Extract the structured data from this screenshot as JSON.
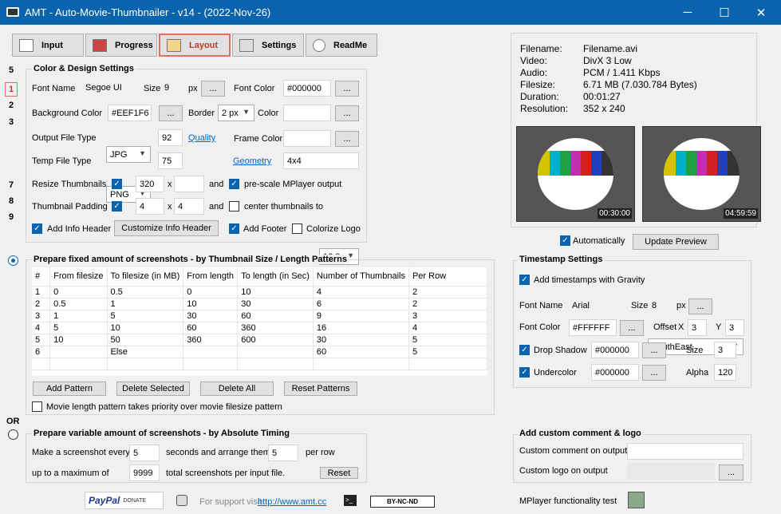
{
  "window": {
    "title": "AMT - Auto-Movie-Thumbnailer - v14 - (2022-Nov-26)",
    "minimize": "─",
    "maximize": "☐",
    "close": "✕"
  },
  "tabs": [
    {
      "label": "Input"
    },
    {
      "label": "Progress"
    },
    {
      "label": "Layout"
    },
    {
      "label": "Settings"
    },
    {
      "label": "ReadMe"
    }
  ],
  "side_nums": [
    "5",
    "1",
    "2",
    "3",
    "7",
    "8",
    "9"
  ],
  "color_design": {
    "title": "Color & Design Settings",
    "font_name_label": "Font Name",
    "font_name": "Segoe UI",
    "size_label": "Size",
    "size": "9",
    "px": "px",
    "dots": "...",
    "font_color_label": "Font Color",
    "font_color": "#000000",
    "bg_color_label": "Background Color",
    "bg_color": "#EEF1F6",
    "border_label": "Border",
    "border": "2 px",
    "color_label": "Color",
    "color": "",
    "output_type_label": "Output File Type",
    "output_type": "JPG",
    "quality_value": "92",
    "quality_link": "Quality",
    "frame_color_label": "Frame Color",
    "frame_color": "",
    "temp_type_label": "Temp File Type",
    "temp_type": "PNG",
    "temp_value": "75",
    "geometry_link": "Geometry",
    "geometry": "4x4",
    "resize_label": "Resize Thumbnails",
    "resize_w": "320",
    "x": "x",
    "resize_h": "",
    "and": "and",
    "prescale_label": "pre-scale MPlayer output",
    "padding_label": "Thumbnail Padding",
    "pad_x": "4",
    "pad_y": "4",
    "center_label": "center thumbnails to",
    "ratio": "16:9",
    "add_info_label": "Add Info Header",
    "customize_btn": "Customize Info Header",
    "add_footer_label": "Add Footer",
    "colorize_label": "Colorize Logo"
  },
  "info": {
    "rows": [
      {
        "k": "Filename:",
        "v": "Filename.avi"
      },
      {
        "k": "Video:",
        "v": "DivX 3 Low"
      },
      {
        "k": "Audio:",
        "v": "PCM / 1.411 Kbps"
      },
      {
        "k": "Filesize:",
        "v": "6.71 MB (7.030.784 Bytes)"
      },
      {
        "k": "Duration:",
        "v": "00:01:27"
      },
      {
        "k": "Resolution:",
        "v": "352 x 240"
      }
    ],
    "thumb1_time": "00:30:00",
    "thumb2_time": "04:59:59",
    "auto_label": "Automatically",
    "update_btn": "Update Preview"
  },
  "fixed": {
    "title": "Prepare fixed amount of screenshots - by Thumbnail Size / Length Patterns",
    "columns": [
      "#",
      "From filesize",
      "To filesize (in MB)",
      "From length",
      "To length (in Sec)",
      "Number of Thumbnails",
      "Per Row"
    ],
    "rows": [
      [
        "1",
        "0",
        "0.5",
        "0",
        "10",
        "4",
        "2"
      ],
      [
        "2",
        "0.5",
        "1",
        "10",
        "30",
        "6",
        "2"
      ],
      [
        "3",
        "1",
        "5",
        "30",
        "60",
        "9",
        "3"
      ],
      [
        "4",
        "5",
        "10",
        "60",
        "360",
        "16",
        "4"
      ],
      [
        "5",
        "10",
        "50",
        "360",
        "600",
        "30",
        "5"
      ],
      [
        "6",
        "",
        "Else",
        "",
        "",
        "60",
        "5"
      ]
    ],
    "add_btn": "Add Pattern",
    "delete_sel_btn": "Delete Selected",
    "delete_all_btn": "Delete All",
    "reset_btn": "Reset Patterns",
    "priority_label": "Movie length pattern takes priority over movie filesize pattern"
  },
  "or_label": "OR",
  "variable": {
    "title": "Prepare variable amount of screenshots - by Absolute Timing",
    "make_label": "Make a screenshot every",
    "every": "5",
    "seconds_label": "seconds and arrange them",
    "per_row": "5",
    "per_row_label": "per row",
    "max_label": "up to a maximum of",
    "max": "9999",
    "total_label": "total screenshots per input file.",
    "reset_btn": "Reset"
  },
  "timestamp": {
    "title": "Timestamp Settings",
    "add_label": "Add timestamps with Gravity",
    "gravity": "SouthEast",
    "font_name_label": "Font Name",
    "font_name": "Arial",
    "size_label": "Size",
    "size": "8",
    "px": "px",
    "dots": "...",
    "font_color_label": "Font Color",
    "font_color": "#FFFFFF",
    "offset_label": "Offset",
    "x_label": "X",
    "offset_x": "3",
    "y_label": "Y",
    "offset_y": "3",
    "drop_label": "Drop Shadow",
    "drop_color": "#000000",
    "dsize_label": "Size",
    "dsize": "3",
    "under_label": "Undercolor",
    "under_color": "#000000",
    "alpha_label": "Alpha",
    "alpha": "120"
  },
  "custom": {
    "title": "Add custom comment & logo",
    "comment_label": "Custom comment on output",
    "comment": "",
    "logo_label": "Custom logo on output",
    "logo": "",
    "dots": "..."
  },
  "footer": {
    "paypal": "PayPal",
    "donate": "DONATE",
    "support": "For support visit",
    "url": "http://www.amt.cc",
    "cc": "BY-NC-ND",
    "mplayer": "MPlayer functionality test"
  }
}
